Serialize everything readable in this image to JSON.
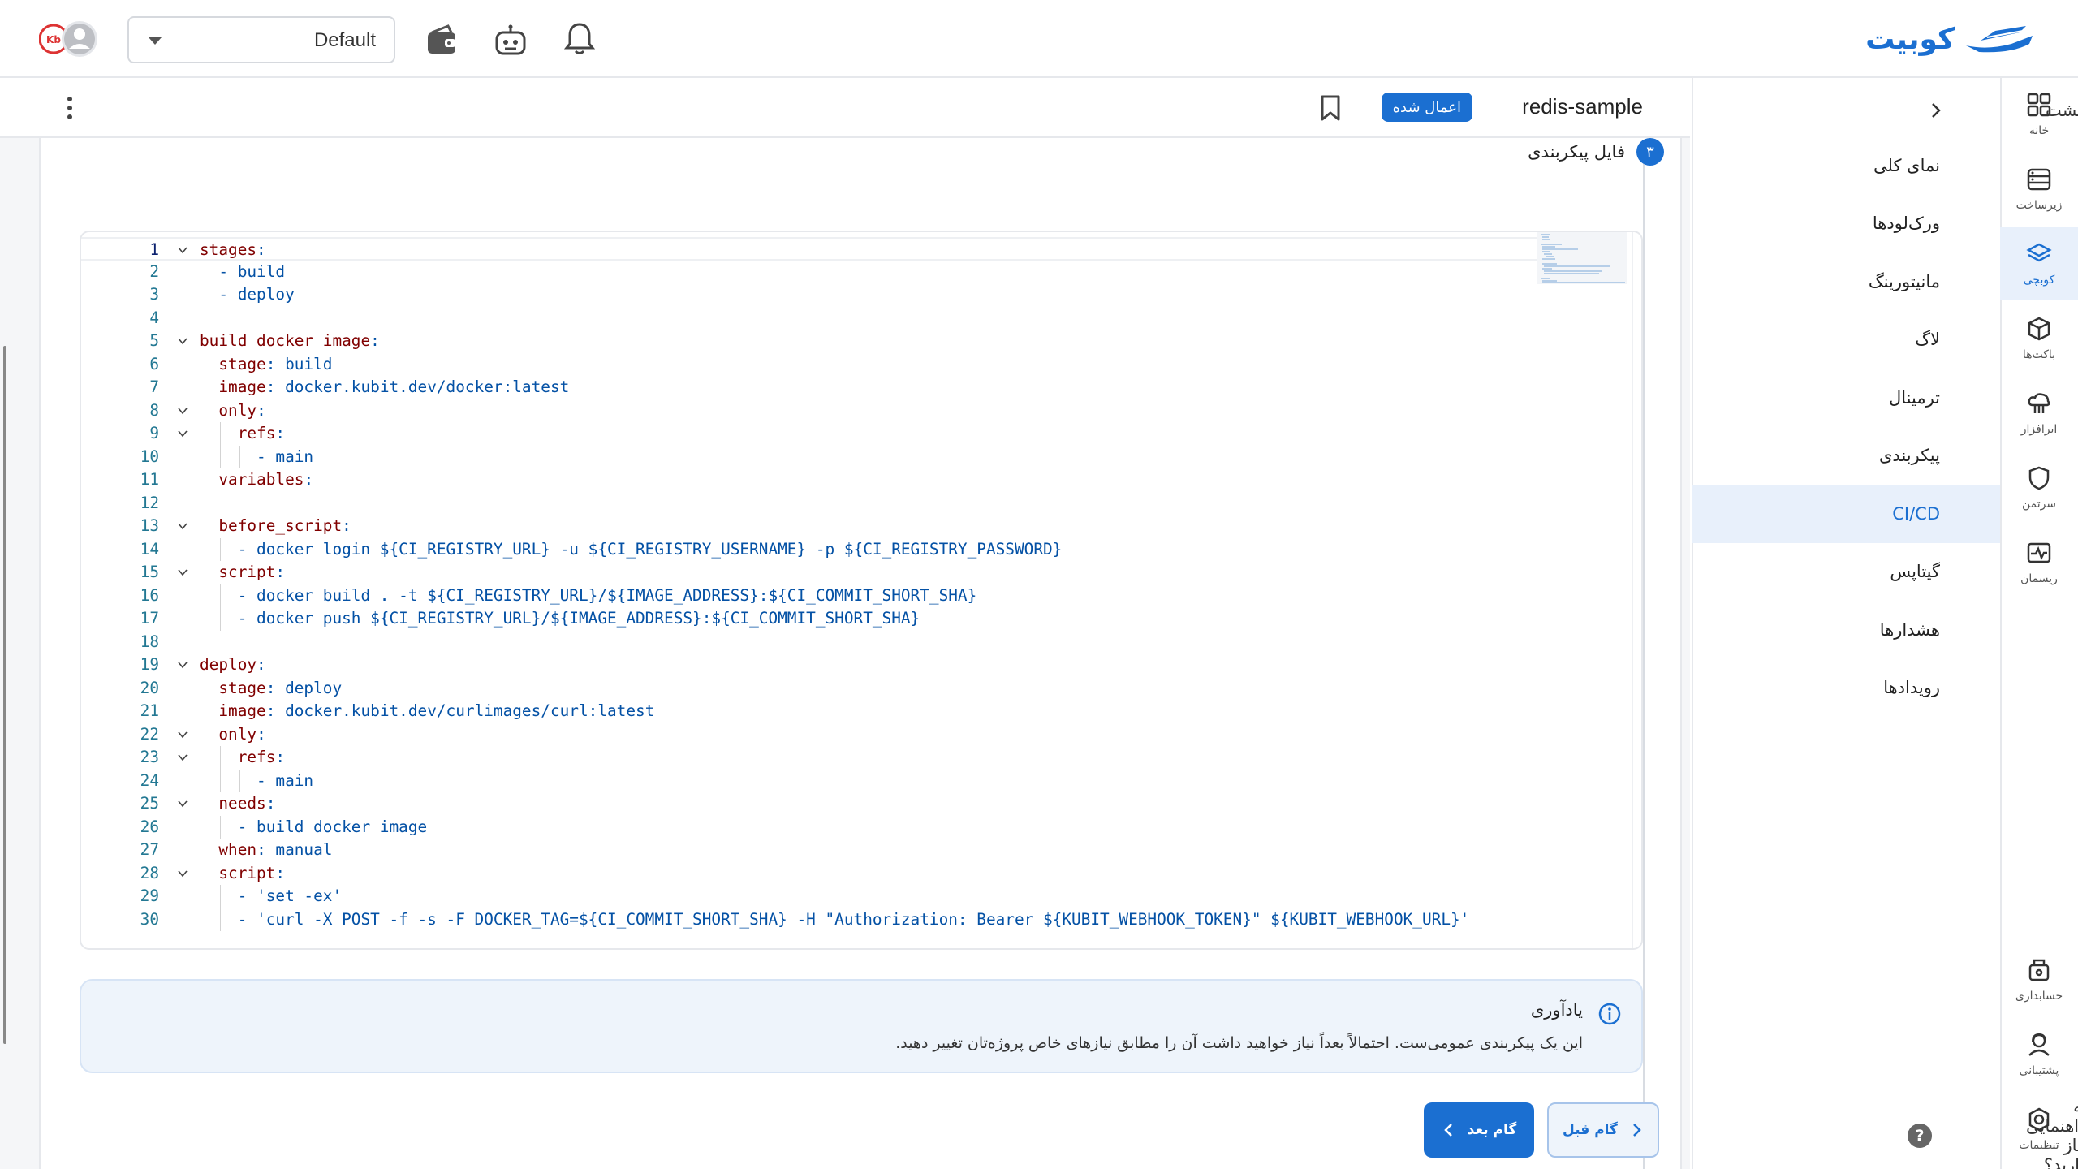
{
  "header": {
    "logo_text": "کوبیت",
    "namespace_select": "Default",
    "accent_color": "#1b6fd1"
  },
  "rail": {
    "items": [
      {
        "label": "خانه",
        "icon": "grid-icon"
      },
      {
        "label": "زیرساخت",
        "icon": "server-icon"
      },
      {
        "label": "کوبچی",
        "icon": "layers-icon",
        "active": true
      },
      {
        "label": "باکت‌ها",
        "icon": "box-icon"
      },
      {
        "label": "ابرافزار",
        "icon": "cloud-app-icon"
      },
      {
        "label": "سرتمن",
        "icon": "shield-icon"
      },
      {
        "label": "ریسمان",
        "icon": "pulse-icon"
      }
    ],
    "bottom": [
      {
        "label": "حسابداری",
        "icon": "accounting-icon"
      },
      {
        "label": "پشتیبانی",
        "icon": "support-icon"
      },
      {
        "label": "تنظیمات",
        "icon": "settings-icon"
      }
    ]
  },
  "subnav": {
    "back_label": "بازگشت",
    "items": [
      "نمای کلی",
      "ورک‌لودها",
      "مانیتورینگ",
      "لاگ",
      "ترمینال",
      "پیکربندی",
      "CI/CD",
      "گیتاپس",
      "هشدارها",
      "رویدادها"
    ],
    "active": "CI/CD",
    "help_label": "به راهنمایی نیاز دارید؟"
  },
  "page": {
    "app_name": "redis-sample",
    "status_badge": "اعمال شده"
  },
  "step": {
    "number": "۳",
    "title": "فایل پیکربندی"
  },
  "editor": {
    "lines": [
      "stages:",
      "  - build",
      "  - deploy",
      "",
      "build docker image:",
      "  stage: build",
      "  image: docker.kubit.dev/docker:latest",
      "  only:",
      "    refs:",
      "      - main",
      "  variables:",
      "",
      "  before_script:",
      "    - docker login ${CI_REGISTRY_URL} -u ${CI_REGISTRY_USERNAME} -p ${CI_REGISTRY_PASSWORD}",
      "  script:",
      "    - docker build . -t ${CI_REGISTRY_URL}/${IMAGE_ADDRESS}:${CI_COMMIT_SHORT_SHA}",
      "    - docker push ${CI_REGISTRY_URL}/${IMAGE_ADDRESS}:${CI_COMMIT_SHORT_SHA}",
      "",
      "deploy:",
      "  stage: deploy",
      "  image: docker.kubit.dev/curlimages/curl:latest",
      "  only:",
      "    refs:",
      "      - main",
      "  needs:",
      "    - build docker image",
      "  when: manual",
      "  script:",
      "    - 'set -ex'",
      "    - 'curl -X POST -f -s -F DOCKER_TAG=${CI_COMMIT_SHORT_SHA} -H \"Authorization: Bearer ${KUBIT_WEBHOOK_TOKEN}\" ${KUBIT_WEBHOOK_URL}'"
    ],
    "foldable_lines": [
      1,
      5,
      8,
      9,
      13,
      15,
      19,
      22,
      23,
      25,
      28
    ]
  },
  "reminder": {
    "title": "یادآوری",
    "body": "این یک پیکربندی عمومی‌ست. احتمالاً بعداً نیاز خواهید داشت آن را مطابق نیازهای خاص پروژه‌تان تغییر دهید."
  },
  "actions": {
    "prev_label": "گام قبل",
    "next_label": "گام بعد"
  }
}
